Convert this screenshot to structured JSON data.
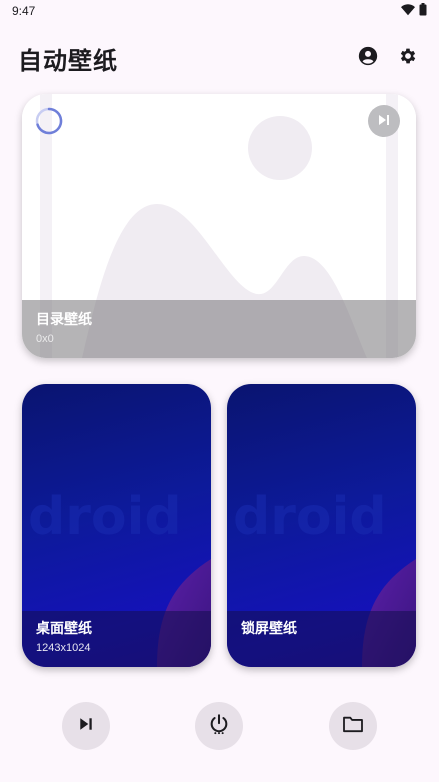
{
  "status_bar": {
    "time": "9:47",
    "icons": [
      "wifi-icon",
      "battery-icon"
    ]
  },
  "app_bar": {
    "title": "自动壁纸",
    "actions": [
      "account-icon",
      "settings-icon"
    ]
  },
  "directory_card": {
    "title": "目录壁纸",
    "resolution": "0x0",
    "loading": true,
    "action_icon": "skip-next-icon"
  },
  "desktop_card": {
    "title": "桌面壁纸",
    "resolution": "1243x1024",
    "watermark": "droid"
  },
  "lock_card": {
    "title": "锁屏壁纸",
    "watermark": "droid"
  },
  "bottom_actions": [
    {
      "icon": "skip-next-icon"
    },
    {
      "icon": "power-icon"
    },
    {
      "icon": "folder-icon"
    }
  ],
  "colors": {
    "background": "#fdf7fd",
    "accent": "#6f7fd9",
    "wallpaper_blue": "#0d1a9a",
    "wallpaper_purple": "#4a1a9e"
  }
}
